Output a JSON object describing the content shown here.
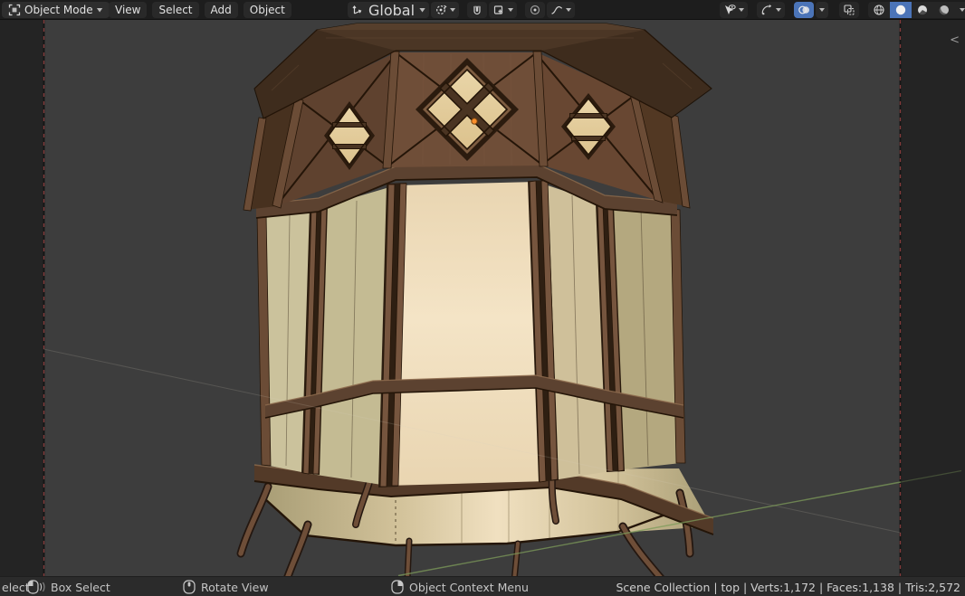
{
  "header": {
    "mode_label": "Object Mode",
    "mode_icon": "object-mode-icon",
    "menus": [
      {
        "label": "View"
      },
      {
        "label": "Select"
      },
      {
        "label": "Add"
      },
      {
        "label": "Object"
      }
    ],
    "transform_orientation": {
      "label": "Global",
      "icon": "orientation-axes-icon"
    },
    "pivot": {
      "icon": "pivot-point-icon"
    },
    "snap": {
      "toggle_icon": "magnet-icon",
      "target_icon": "snap-target-icon",
      "enabled": false
    },
    "proportional": {
      "toggle_icon": "proportional-editing-icon",
      "falloff_icon": "falloff-curve-icon"
    },
    "right_icons": [
      {
        "name": "visibility-icon",
        "active": false
      },
      {
        "name": "gizmo-icon",
        "active": false
      },
      {
        "name": "overlays-icon",
        "active": true
      },
      {
        "name": "xray-icon",
        "active": false
      },
      {
        "name": "wireframe-shading-icon",
        "active": false
      },
      {
        "name": "solid-shading-icon",
        "active": true
      },
      {
        "name": "material-shading-icon",
        "active": false
      },
      {
        "name": "rendered-shading-icon",
        "active": false
      }
    ]
  },
  "viewport": {
    "sidebar_toggle": "<",
    "scene_object": "wooden lantern tower 3d model",
    "origin_dot_color": "#fa8f2c"
  },
  "statusbar": {
    "items": [
      {
        "icon": null,
        "label": "elect"
      },
      {
        "icon": "mouse-left-drag-icon",
        "label": "Box Select"
      },
      {
        "icon": "mouse-middle-icon",
        "label": "Rotate View"
      },
      {
        "icon": "mouse-right-icon",
        "label": "Object Context Menu"
      }
    ],
    "right_text": "Scene Collection | top | Verts:1,172 | Faces:1,138 | Tris:2,572"
  },
  "colors": {
    "accent_blue": "#4b74b8",
    "header_bg": "#1d1d1d",
    "button_bg": "#2e2e2e",
    "statusbar_bg": "#2b2b2b",
    "status_text": "#c5c5c5",
    "viewport_bg": "#3d3d3d",
    "outside_bg": "#242424",
    "camera_border": "#c05050",
    "wood_dark": "#3e2c1d",
    "wood_cornice_top": "#563f2c",
    "wood_fascia": "#4b3625",
    "frieze_front": "#6f4e38",
    "frieze_side_l": "#5f422f",
    "frieze_side_r": "#684732",
    "frieze_far_l": "#47311f",
    "frieze_far_r": "#523823",
    "post": "#6b4c36",
    "post_light": "#76553e",
    "rail": "#5c4230",
    "rim": "#533a28",
    "pane_cream": "#e9d5a8",
    "pane_dim": "#dcc28d",
    "bar_wood": "#4a3422",
    "edge_dark": "#241508",
    "body_front": "#e9d5b1",
    "body_front_hi": "#f4e4c6",
    "body_left": "#c4bb93",
    "body_far_left": "#cbc29c",
    "body_right": "#cfc09a",
    "body_far_right": "#b4a87f",
    "interior_hi": "#f0e0c0",
    "interior_mid": "#d2c29a",
    "interior_dim": "#a99e76",
    "leg": "#6e4e38",
    "leg_outline": "#241710",
    "axis_green": "#7d9b5a",
    "axis_faint": "#d8d0c0",
    "origin_orange": "#fa8f2c"
  }
}
